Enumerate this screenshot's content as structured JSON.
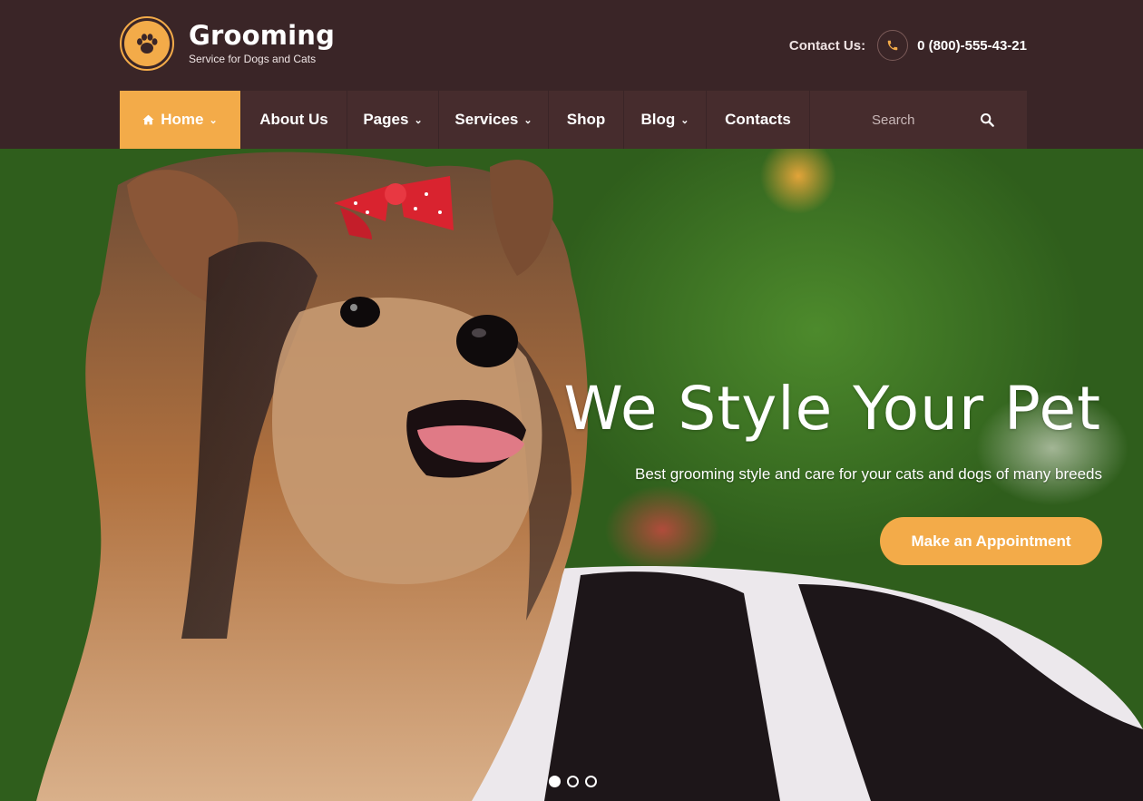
{
  "brand": {
    "title": "Grooming",
    "subtitle": "Service for Dogs and Cats",
    "logo_icon": "paw-icon",
    "accent_color": "#f3ab49",
    "header_bg": "#3a2527",
    "nav_bg": "#462c2d"
  },
  "contact": {
    "label": "Contact Us:",
    "phone": "0 (800)-555-43-21",
    "icon": "phone-icon"
  },
  "nav": {
    "items": [
      {
        "label": "Home",
        "active": true,
        "dropdown": true,
        "icon": "home-icon"
      },
      {
        "label": "About Us",
        "active": false,
        "dropdown": false
      },
      {
        "label": "Pages",
        "active": false,
        "dropdown": true
      },
      {
        "label": "Services",
        "active": false,
        "dropdown": true
      },
      {
        "label": "Shop",
        "active": false,
        "dropdown": false
      },
      {
        "label": "Blog",
        "active": false,
        "dropdown": true
      },
      {
        "label": "Contacts",
        "active": false,
        "dropdown": false
      }
    ],
    "search": {
      "placeholder": "Search",
      "icon": "search-icon"
    }
  },
  "hero": {
    "title": "We Style Your Pet",
    "subtitle": "Best grooming style and care for your cats and dogs of many breeds",
    "cta_label": "Make an Appointment",
    "slides_count": 3,
    "active_slide": 1
  }
}
